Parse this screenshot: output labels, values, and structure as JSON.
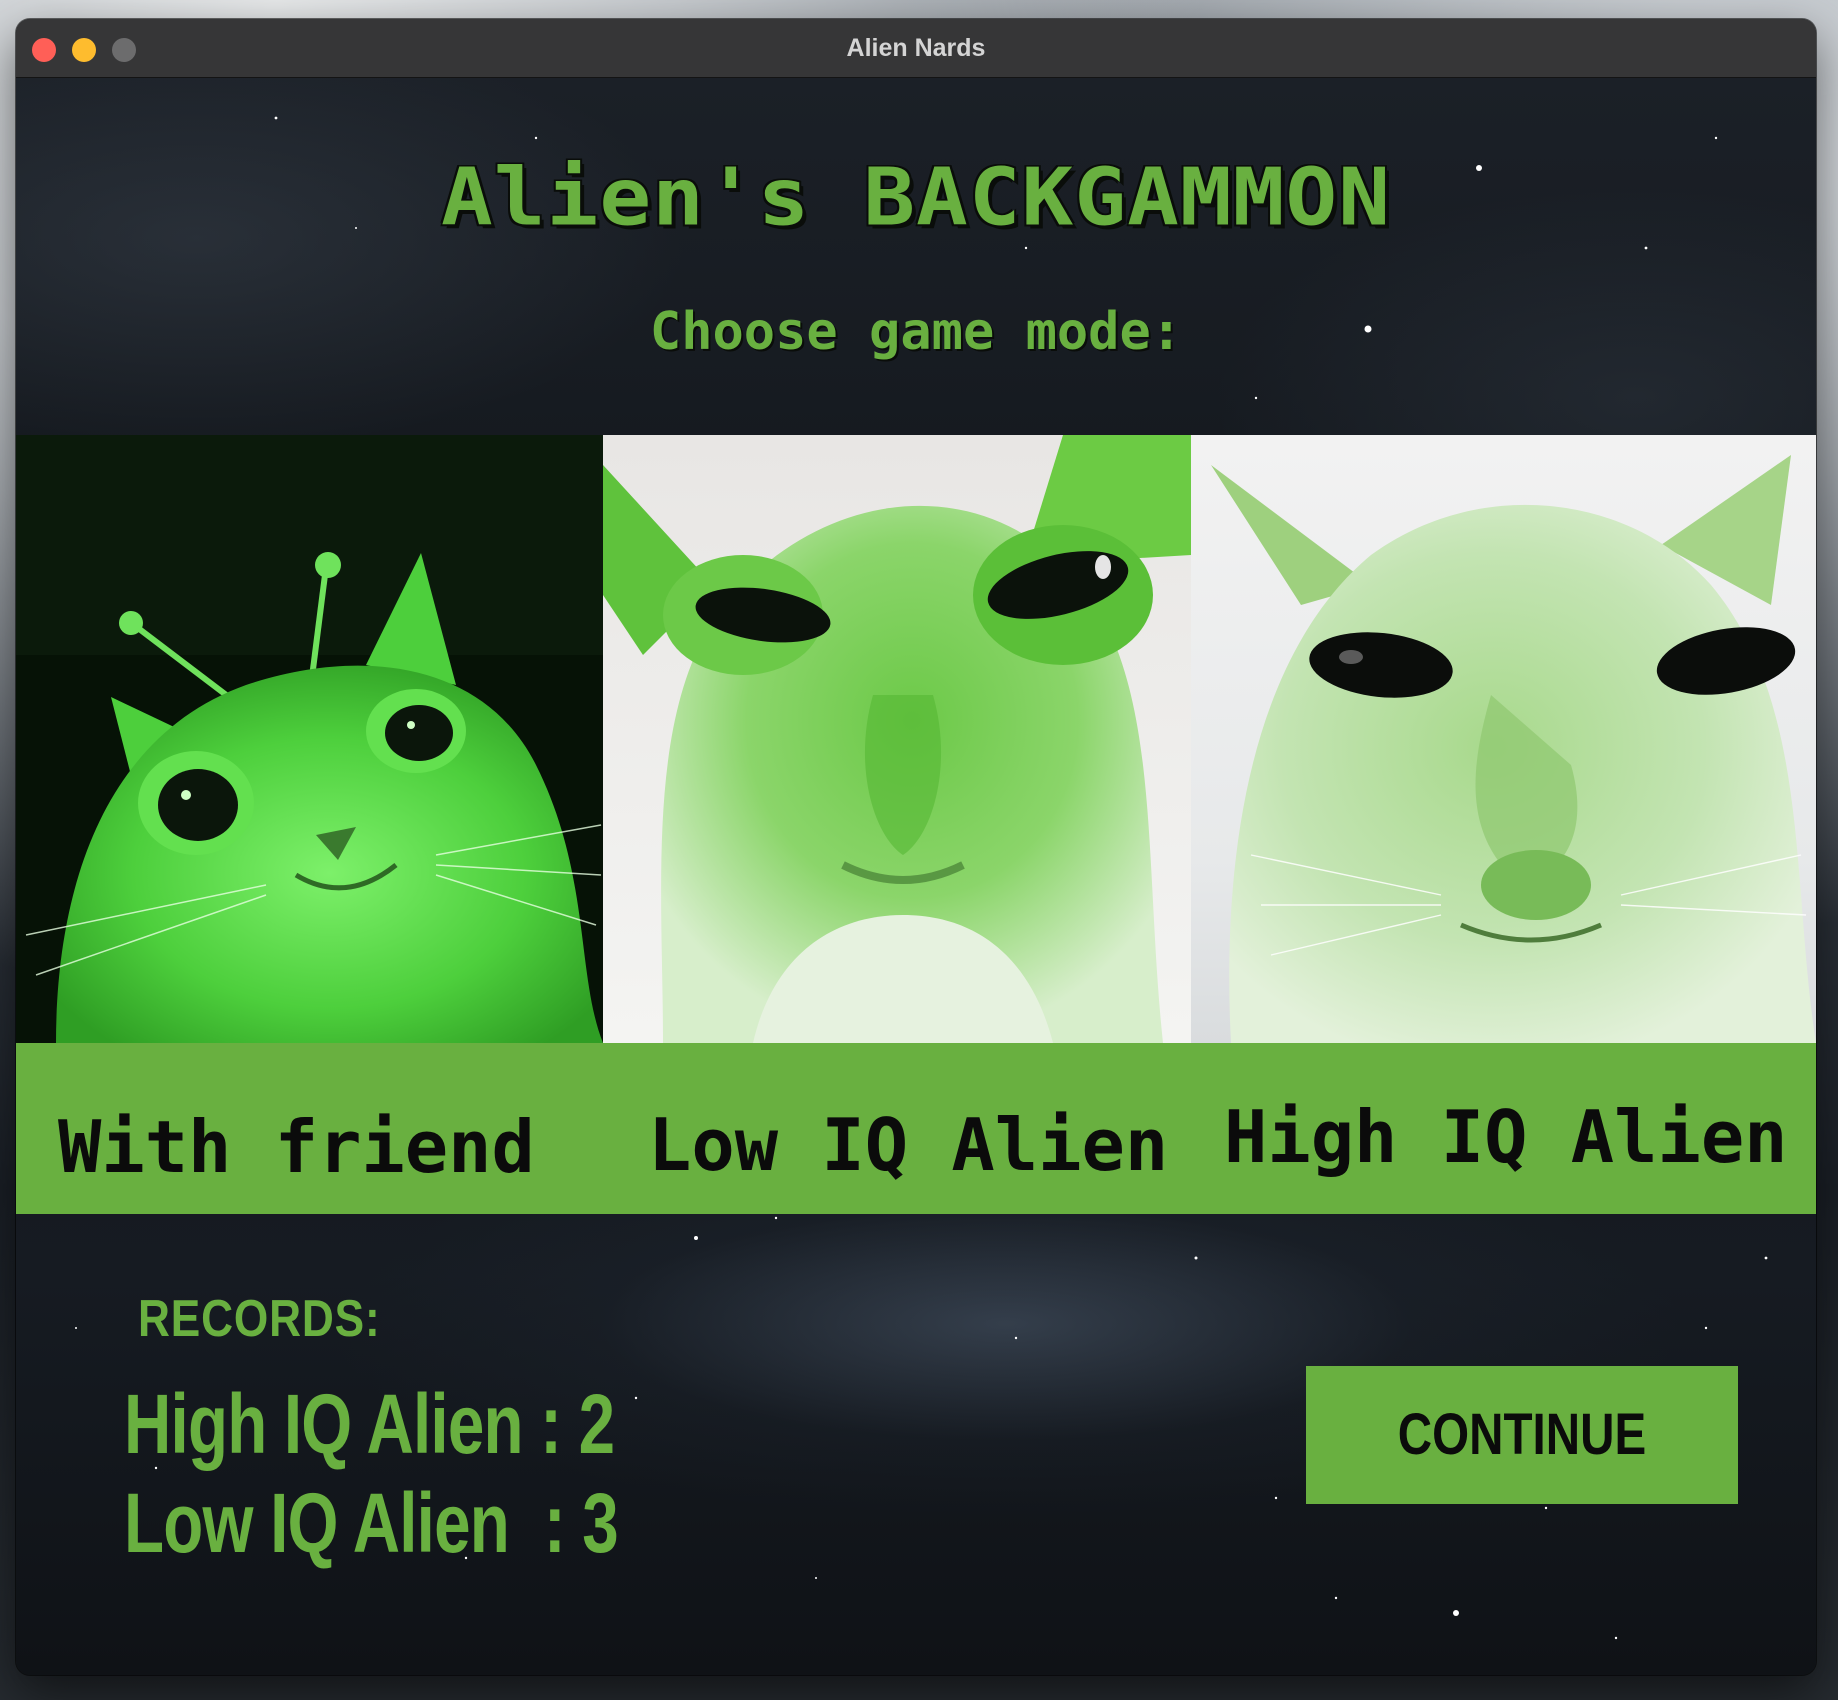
{
  "window": {
    "title": "Alien Nards"
  },
  "game": {
    "title": "Alien's BACKGAMMON",
    "subtitle": "Choose game mode:"
  },
  "modes": [
    {
      "label": "With friend",
      "image": "green alien cat with antennae"
    },
    {
      "label": "Low IQ Alien",
      "image": "green alien cat face close-up"
    },
    {
      "label": "High IQ Alien",
      "image": "green alien cat staring"
    }
  ],
  "records": {
    "heading": "RECORDS:",
    "lines": [
      "High IQ Alien : 2",
      "Low IQ Alien  : 3"
    ]
  },
  "actions": {
    "continue_label": "CONTINUE"
  },
  "colors": {
    "accent_green": "#69b040",
    "background": "#14181d",
    "titlebar": "#363637"
  }
}
